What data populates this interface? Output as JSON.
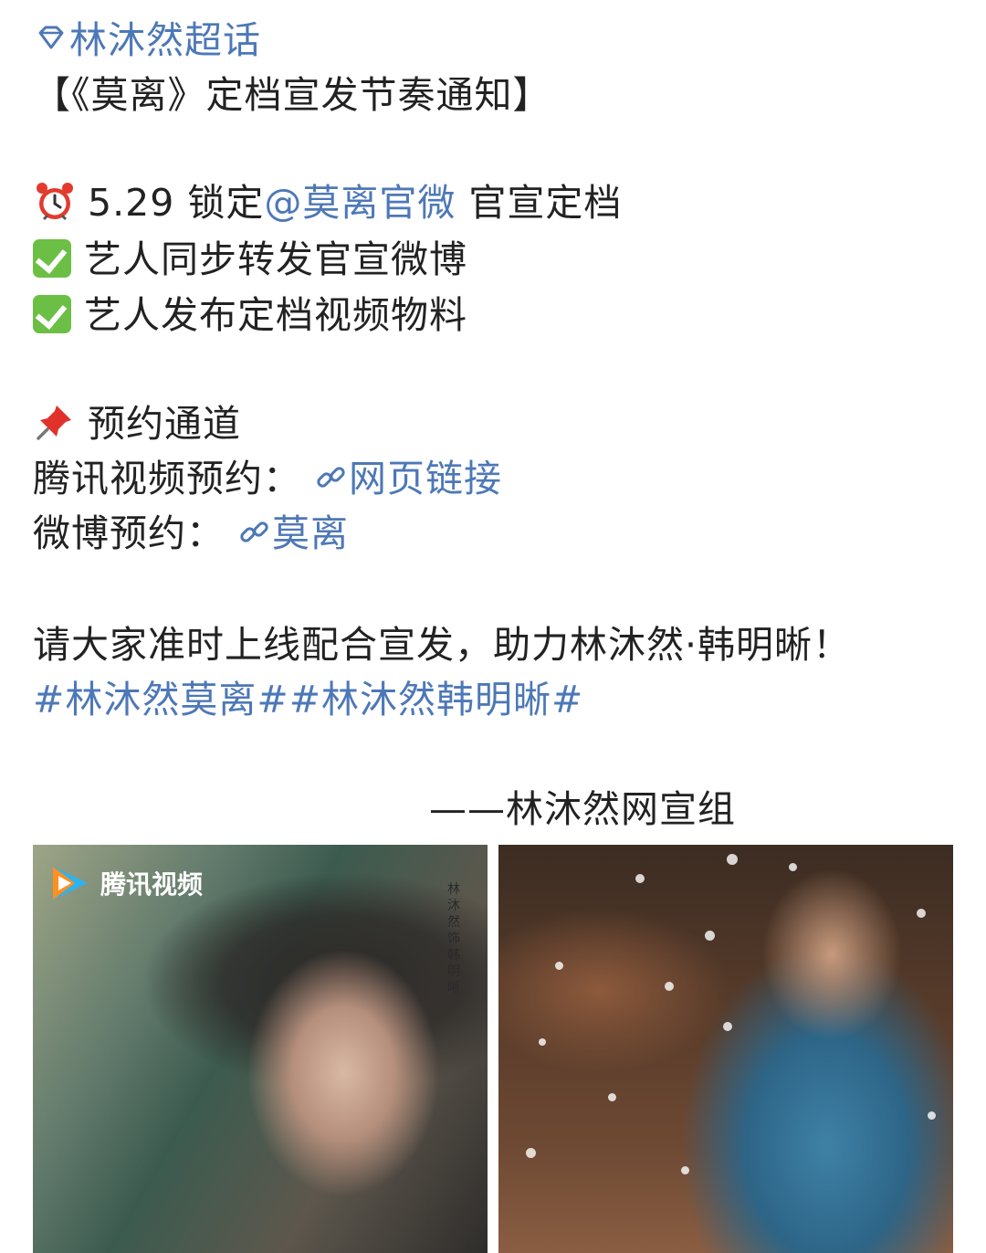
{
  "post": {
    "super_topic": "林沐然超话",
    "title": "【《莫离》定档宣发节奏通知】",
    "schedule": {
      "date": "5.29",
      "lock_text": "锁定",
      "official_account": "@莫离官微",
      "announce_text": "官宣定档"
    },
    "tasks": [
      "艺人同步转发官宣微博",
      "艺人发布定档视频物料"
    ],
    "reservation": {
      "heading": "预约通道",
      "tencent_label": "腾讯视频预约：",
      "tencent_link": "网页链接",
      "weibo_label": "微博预约：",
      "weibo_link": "莫离"
    },
    "call_to_action": "请大家准时上线配合宣发，助力林沐然·韩明晰！",
    "hashtags": "#林沐然莫离##林沐然韩明晰#",
    "signature": "——林沐然网宣组"
  },
  "images": {
    "poster_logo_text": "腾讯视频",
    "poster_credit": "林沐然饰韩明晰"
  },
  "colors": {
    "link": "#4d78b7",
    "text": "#222222",
    "check": "#6cbf45"
  }
}
